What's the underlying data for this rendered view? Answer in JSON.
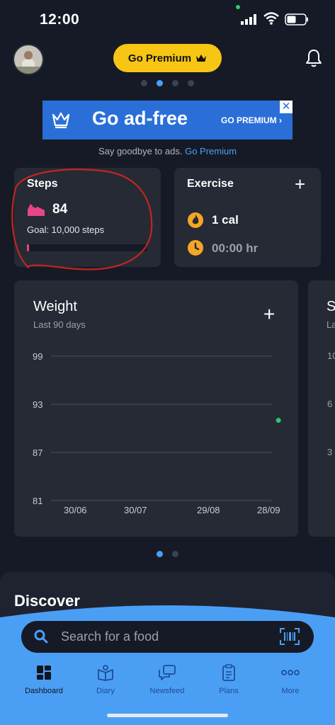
{
  "status": {
    "time": "12:00"
  },
  "header": {
    "premium_label": "Go Premium"
  },
  "ad": {
    "title": "Go ad-free",
    "cta": "GO PREMIUM ›",
    "close": "✕",
    "caption": "Say goodbye to ads.",
    "caption_link": "Go Premium"
  },
  "steps": {
    "title": "Steps",
    "value": "84",
    "goal": "Goal: 10,000 steps",
    "progress": 0.0084
  },
  "exercise": {
    "title": "Exercise",
    "add": "+",
    "calories": "1 cal",
    "duration": "00:00 hr"
  },
  "weight": {
    "title": "Weight",
    "subtitle": "Last 90 days",
    "add": "+"
  },
  "next_card": {
    "letter": "S",
    "sub": "La",
    "ticks": [
      "10",
      "6",
      "3"
    ]
  },
  "chart_data": {
    "type": "scatter",
    "title": "Weight",
    "subtitle": "Last 90 days",
    "x_ticks": [
      "30/06",
      "30/07",
      "29/08",
      "28/09"
    ],
    "y_ticks": [
      99,
      93,
      87,
      81
    ],
    "ylim": [
      81,
      99
    ],
    "grid": true,
    "points": [
      {
        "x": "03/10",
        "y": 91
      }
    ],
    "point_color": "#2fc46b"
  },
  "discover": {
    "title": "Discover"
  },
  "search": {
    "placeholder": "Search for a food"
  },
  "tabs": [
    {
      "label": "Dashboard",
      "icon": "dashboard-icon",
      "active": true
    },
    {
      "label": "Diary",
      "icon": "diary-icon",
      "active": false
    },
    {
      "label": "Newsfeed",
      "icon": "newsfeed-icon",
      "active": false
    },
    {
      "label": "Plans",
      "icon": "plans-icon",
      "active": false
    },
    {
      "label": "More",
      "icon": "more-icon",
      "active": false
    }
  ],
  "colors": {
    "background": "#161a26",
    "card": "#262a35",
    "premium": "#f7c514",
    "accent_blue": "#4a9ff5",
    "ad_blue": "#2a6fd8",
    "steps_pink": "#e64683",
    "bottom_blue": "#4a9ff5"
  }
}
